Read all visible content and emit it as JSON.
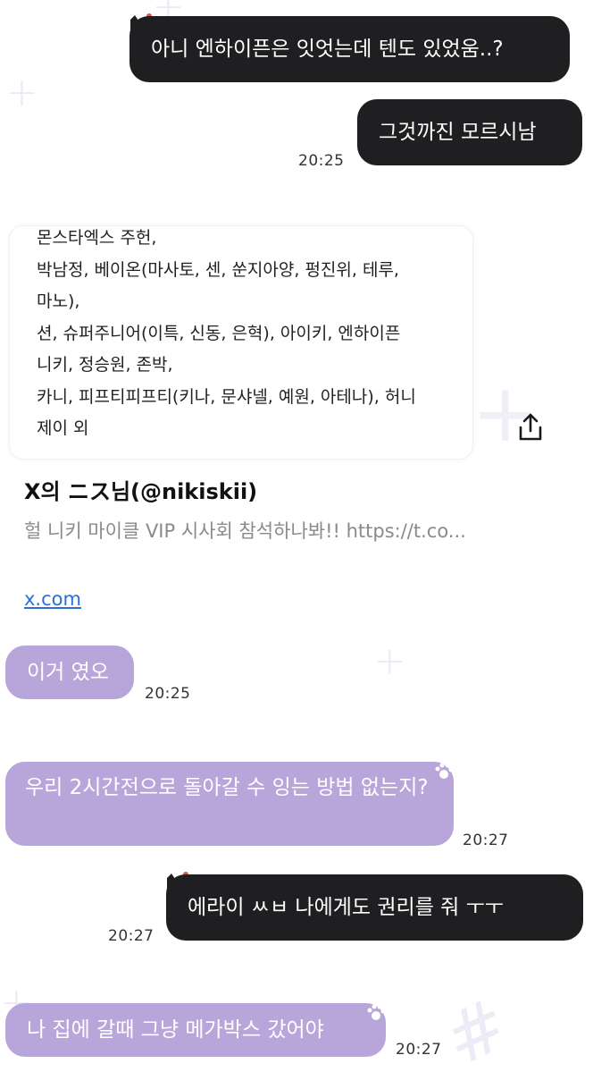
{
  "messages": [
    {
      "text": "아니 엔하이픈은 잇엇는데 텐도 있었움..?"
    },
    {
      "text": "그것까진 모르시남",
      "time": "20:25"
    },
    {
      "text": "이거 였오",
      "time": "20:25"
    },
    {
      "text": "우리 2시간전으로 돌아갈 수 잉는 방법 없는지?",
      "time": "20:27"
    },
    {
      "text": "에라이 ㅆㅂ 나에게도 권리를 줘 ㅜㅜ",
      "time": "20:27"
    },
    {
      "text": "나 집에 갈때 그냥 메가박스 갔어야",
      "time": "20:27"
    }
  ],
  "link_card": {
    "preview_lines": [
      "몬스타엑스 주헌,",
      "박남정, 베이온(마사토, 센, 쑨지아양, 펑진위, 테루,",
      "마노),",
      "션, 슈퍼주니어(이특, 신동, 은혁), 아이키, 엔하이픈",
      "니키, 정승원, 존박,",
      "카니, 피프티피프티(키나, 문샤넬, 예원, 아테나), 허니",
      "제이 외"
    ],
    "title": "X의 ニス님(@nikiskii)",
    "description": "헐 니키 마이클 VIP 시사회 참석하나봐!! https://t.co...",
    "domain": "x.com"
  },
  "colors": {
    "dark_bubble": "#1f1f22",
    "purple_bubble": "#b8a5d9",
    "link": "#2b6fd6",
    "muted_text": "#8a8a8a"
  },
  "icons": [
    "share-icon",
    "cat-sticker-icon",
    "paw-icon"
  ]
}
